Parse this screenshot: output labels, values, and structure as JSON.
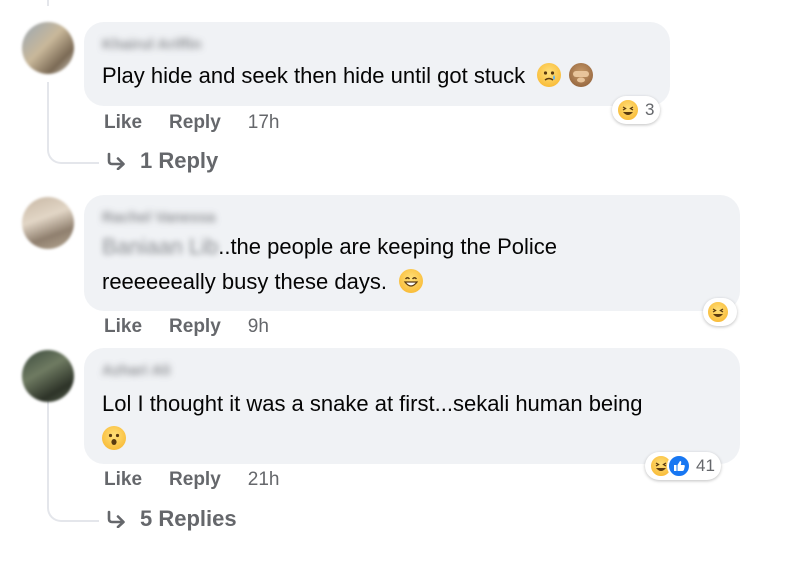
{
  "comments": [
    {
      "author": "Khairul Ariffin",
      "text": "Play hide and seek then hide until got stuck",
      "emoji_after_text": [
        "sad-tear-emoji",
        "see-no-evil-monkey-emoji"
      ],
      "actions": {
        "like": "Like",
        "reply": "Reply",
        "time": "17h"
      },
      "reactions": {
        "icons": [
          "haha"
        ],
        "count": "3"
      },
      "replies_label": "1 Reply"
    },
    {
      "author": "Rachel Vanessa",
      "mention": "Baniaan Lib",
      "text_line1": "..the people are keeping the Police",
      "text_line2": "reeeeeeally busy these days.",
      "emoji_after_text": [
        "grinning-emoji"
      ],
      "actions": {
        "like": "Like",
        "reply": "Reply",
        "time": "9h"
      },
      "reactions": {
        "icons": [
          "haha"
        ],
        "count": ""
      }
    },
    {
      "author": "Azhari Ali",
      "text": "Lol I thought it was a snake at first...sekali human being",
      "emoji_after_text": [
        "surprised-emoji"
      ],
      "actions": {
        "like": "Like",
        "reply": "Reply",
        "time": "21h"
      },
      "reactions": {
        "icons": [
          "haha",
          "like"
        ],
        "count": "41"
      },
      "replies_label": "5 Replies"
    }
  ],
  "colors": {
    "bubble": "#f0f2f5",
    "meta_text": "#65676b",
    "body_text": "#050505",
    "like_blue": "#1877f2",
    "haha_yellow": "#f7b125"
  }
}
